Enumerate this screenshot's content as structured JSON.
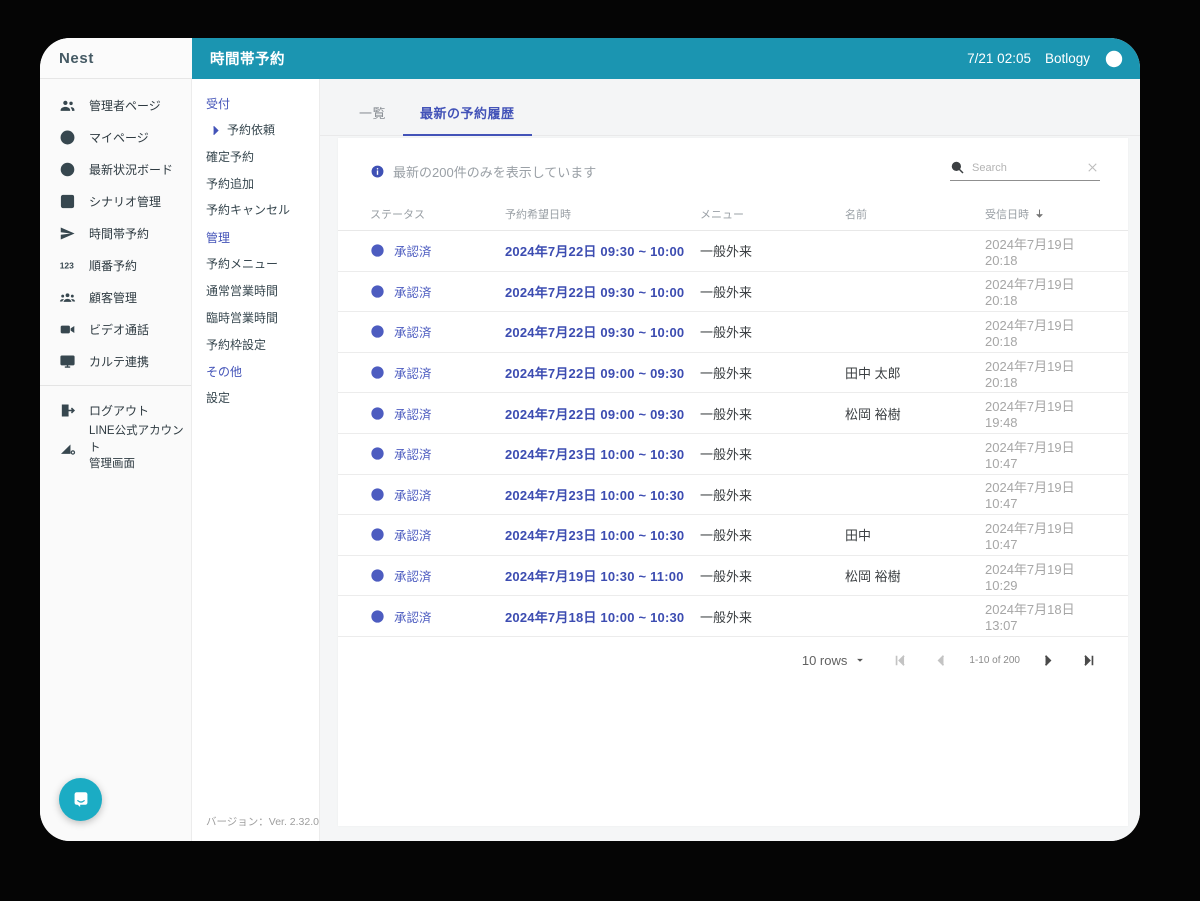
{
  "brand": {
    "name": "Nest"
  },
  "topbar": {
    "title": "時間帯予約",
    "clock": "7/21 02:05",
    "user": "Botlogy"
  },
  "nav": {
    "items": [
      {
        "id": "admin-page",
        "label": "管理者ページ",
        "icon": "admin-users-icon"
      },
      {
        "id": "my-page",
        "label": "マイページ",
        "icon": "person-circle-icon"
      },
      {
        "id": "status-board",
        "label": "最新状況ボード",
        "icon": "clock-icon"
      },
      {
        "id": "scenario",
        "label": "シナリオ管理",
        "icon": "list-icon"
      },
      {
        "id": "time-slot",
        "label": "時間帯予約",
        "icon": "send-icon"
      },
      {
        "id": "queue",
        "label": "順番予約",
        "icon": "numbers-icon"
      },
      {
        "id": "customers",
        "label": "顧客管理",
        "icon": "people-icon"
      },
      {
        "id": "video-call",
        "label": "ビデオ通話",
        "icon": "video-icon"
      },
      {
        "id": "karte",
        "label": "カルテ連携",
        "icon": "monitor-icon"
      }
    ],
    "footer_items": [
      {
        "id": "logout",
        "label": "ログアウト",
        "icon": "logout-icon"
      },
      {
        "id": "line-admin",
        "label": "LINE公式アカウント管理画面",
        "label_lines": [
          "LINE公式アカウント",
          "管理画面"
        ],
        "icon": "chart-icon"
      }
    ]
  },
  "submenu": {
    "groups": [
      {
        "title": "受付",
        "items": [
          {
            "label": "予約依頼",
            "selected": true
          },
          {
            "label": "確定予約"
          },
          {
            "label": "予約追加"
          },
          {
            "label": "予約キャンセル"
          }
        ]
      },
      {
        "title": "管理",
        "items": [
          {
            "label": "予約メニュー"
          },
          {
            "label": "通常営業時間"
          },
          {
            "label": "臨時営業時間"
          },
          {
            "label": "予約枠設定"
          }
        ]
      },
      {
        "title": "その他",
        "items": [
          {
            "label": "設定"
          }
        ]
      }
    ],
    "version": "バージョン：Ver. 2.32.0"
  },
  "main": {
    "tabs": [
      {
        "label": "一覧",
        "active": false
      },
      {
        "label": "最新の予約履歴",
        "active": true
      }
    ],
    "notice": "最新の200件のみを表示しています",
    "search": {
      "placeholder": "Search",
      "value": ""
    },
    "table": {
      "columns": [
        "ステータス",
        "予約希望日時",
        "メニュー",
        "名前",
        "受信日時"
      ],
      "sorted_by": "受信日時",
      "sort_direction": "desc",
      "rows": [
        {
          "status": "承認済",
          "datetime": "2024年7月22日 09:30 ~ 10:00",
          "menu": "一般外来",
          "name": "",
          "received": "2024年7月19日 20:18"
        },
        {
          "status": "承認済",
          "datetime": "2024年7月22日 09:30 ~ 10:00",
          "menu": "一般外来",
          "name": "",
          "received": "2024年7月19日 20:18"
        },
        {
          "status": "承認済",
          "datetime": "2024年7月22日 09:30 ~ 10:00",
          "menu": "一般外来",
          "name": "",
          "received": "2024年7月19日 20:18"
        },
        {
          "status": "承認済",
          "datetime": "2024年7月22日 09:00 ~ 09:30",
          "menu": "一般外来",
          "name": "田中 太郎",
          "received": "2024年7月19日 20:18"
        },
        {
          "status": "承認済",
          "datetime": "2024年7月22日 09:00 ~ 09:30",
          "menu": "一般外来",
          "name": "松岡 裕樹",
          "received": "2024年7月19日 19:48"
        },
        {
          "status": "承認済",
          "datetime": "2024年7月23日 10:00 ~ 10:30",
          "menu": "一般外来",
          "name": "",
          "received": "2024年7月19日 10:47"
        },
        {
          "status": "承認済",
          "datetime": "2024年7月23日 10:00 ~ 10:30",
          "menu": "一般外来",
          "name": "",
          "received": "2024年7月19日 10:47"
        },
        {
          "status": "承認済",
          "datetime": "2024年7月23日 10:00 ~ 10:30",
          "menu": "一般外来",
          "name": "田中",
          "received": "2024年7月19日 10:47"
        },
        {
          "status": "承認済",
          "datetime": "2024年7月19日 10:30 ~ 11:00",
          "menu": "一般外来",
          "name": "松岡 裕樹",
          "received": "2024年7月19日 10:29"
        },
        {
          "status": "承認済",
          "datetime": "2024年7月18日 10:00 ~ 10:30",
          "menu": "一般外来",
          "name": "",
          "received": "2024年7月18日 13:07"
        }
      ]
    },
    "pagination": {
      "rows_label": "10 rows",
      "range_label": "1-10 of 200"
    }
  },
  "colors": {
    "topbar_teal": "#1b95b1",
    "accent_indigo": "#4353b8",
    "status_blue": "#4d5cc0",
    "fab_teal": "#1bacc4"
  }
}
